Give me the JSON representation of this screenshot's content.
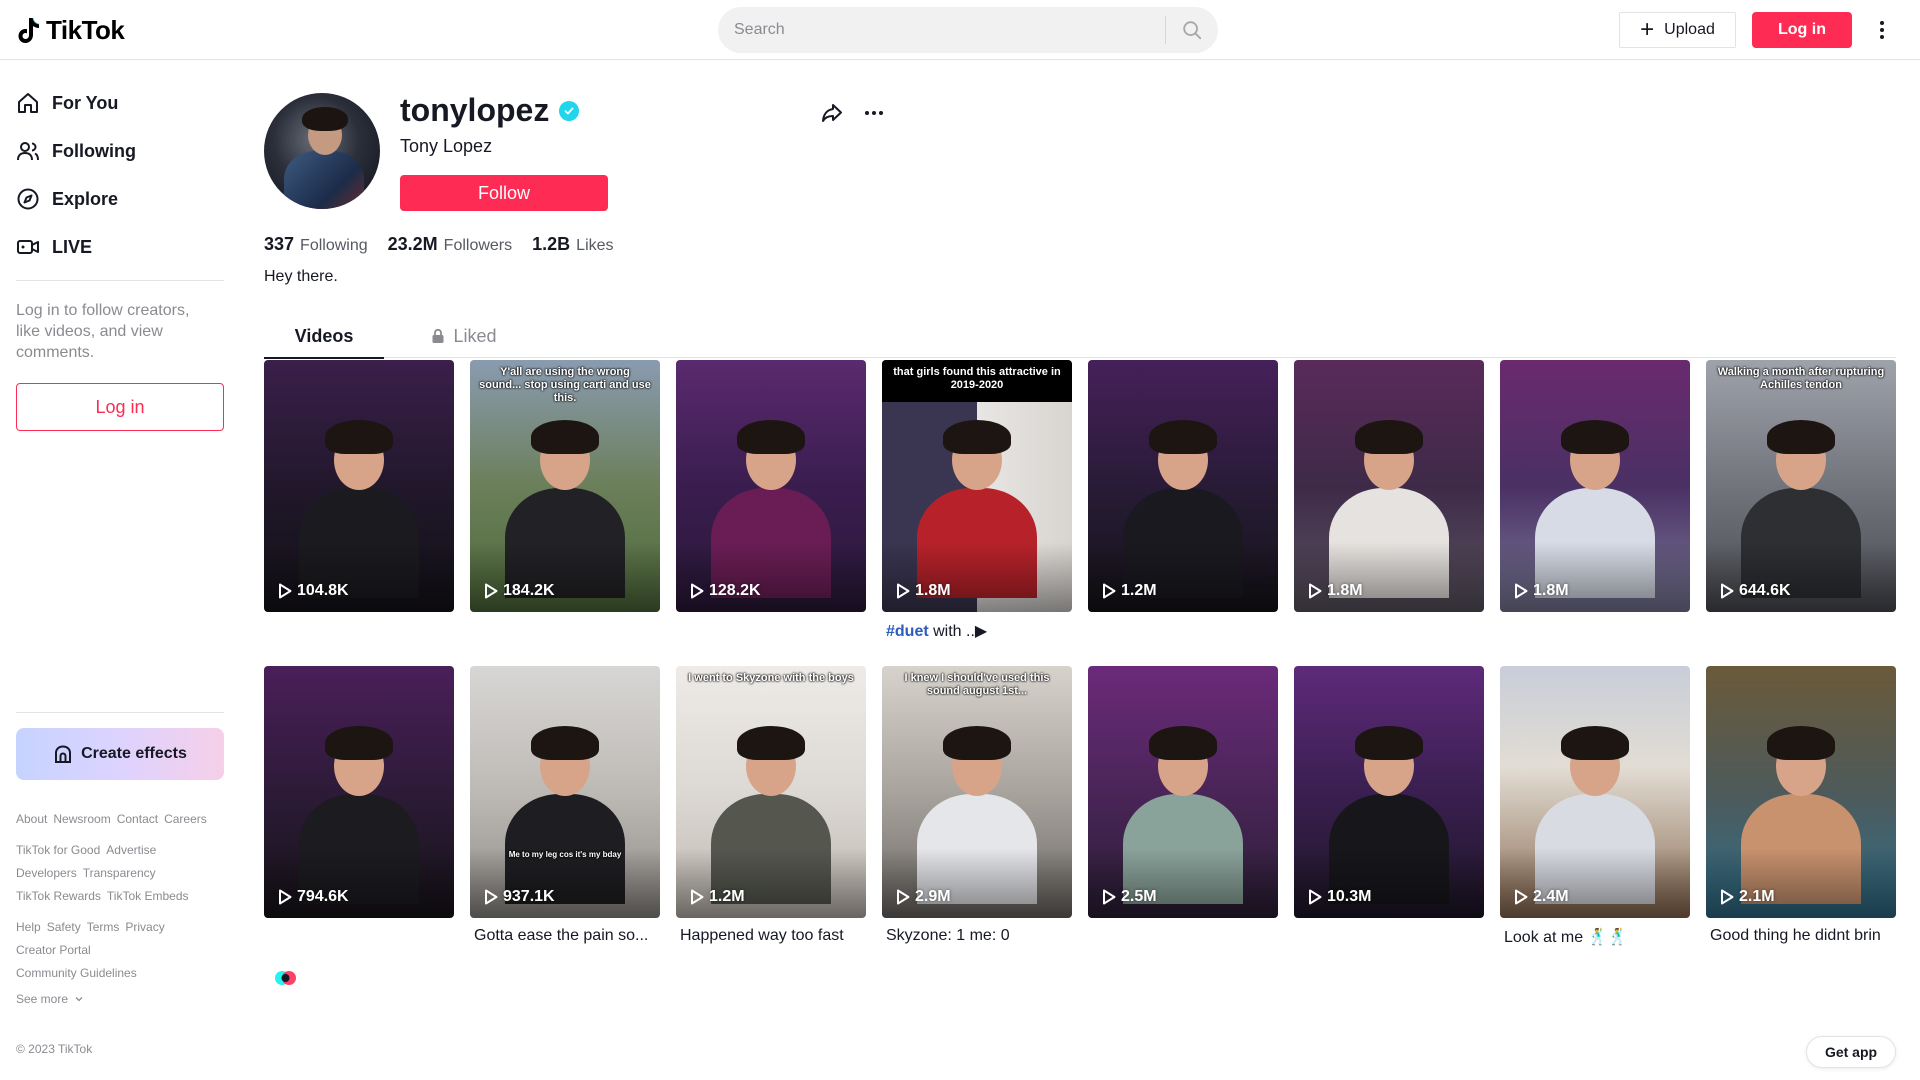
{
  "header": {
    "logo_text": "TikTok",
    "search_placeholder": "Search",
    "upload_label": "Upload",
    "login_label": "Log in"
  },
  "sidebar": {
    "nav": [
      {
        "label": "For You",
        "icon": "home-icon"
      },
      {
        "label": "Following",
        "icon": "people-icon"
      },
      {
        "label": "Explore",
        "icon": "compass-icon"
      },
      {
        "label": "LIVE",
        "icon": "live-camera-icon"
      }
    ],
    "login_hint": "Log in to follow creators, like videos, and view comments.",
    "login_button": "Log in",
    "create_effects": "Create effects",
    "footer_links": [
      [
        "About",
        "Newsroom",
        "Contact",
        "Careers"
      ],
      [
        "TikTok for Good",
        "Advertise"
      ],
      [
        "Developers",
        "Transparency"
      ],
      [
        "TikTok Rewards",
        "TikTok Embeds"
      ],
      [
        "Help",
        "Safety",
        "Terms",
        "Privacy"
      ],
      [
        "Creator Portal"
      ],
      [
        "Community Guidelines"
      ]
    ],
    "see_more": "See more",
    "copyright": "© 2023 TikTok"
  },
  "profile": {
    "username": "tonylopez",
    "nickname": "Tony Lopez",
    "follow_label": "Follow",
    "stats": {
      "following_count": "337",
      "following_label": "Following",
      "followers_count": "23.2M",
      "followers_label": "Followers",
      "likes_count": "1.2B",
      "likes_label": "Likes"
    },
    "bio": "Hey there."
  },
  "tabs": {
    "videos": "Videos",
    "liked": "Liked"
  },
  "videos": [
    {
      "views": "104.8K",
      "caption": "",
      "desc": "",
      "bg": "linear-gradient(180deg,#3a1f4a 0%,#1d1626 60%,#141218 100%)",
      "body": "#1b1a1f"
    },
    {
      "views": "184.2K",
      "caption": "Y'all are using the wrong sound... stop using carti and use this.",
      "desc": "",
      "bg": "linear-gradient(180deg,#8a9bb0 0%,#6b7f5a 50%,#4e6a3a 100%)",
      "body": "#222226"
    },
    {
      "views": "128.2K",
      "caption": "",
      "desc": "",
      "bg": "linear-gradient(180deg,#5a2a6e 0%,#3a1d4f 50%,#2a1838 100%)",
      "body": "#6a1d55"
    },
    {
      "views": "1.8M",
      "caption": "that girls found this attractive in 2019-2020",
      "desc_tag": "#duet",
      "desc": " with ..▶",
      "bg": "linear-gradient(90deg,#3a3550 0%,#3a3550 50%,#e8e6e4 50%,#d8d4d0 100%)",
      "body": "#b7222a",
      "top_black": true
    },
    {
      "views": "1.2M",
      "caption": "",
      "desc": "",
      "bg": "linear-gradient(180deg,#46205a 0%,#231a30 60%,#161218 100%)",
      "body": "#1a1920"
    },
    {
      "views": "1.8M",
      "caption": "",
      "desc": "",
      "bg": "linear-gradient(180deg,#5a2a5a 0%,#3e2a48 50%,#5b5560 100%)",
      "body": "#e6e2df"
    },
    {
      "views": "1.8M",
      "caption": "",
      "desc": "",
      "bg": "linear-gradient(180deg,#6a2a6e 0%,#4a3064 50%,#7c7d9a 100%)",
      "body": "#d7dbe6"
    },
    {
      "views": "644.6K",
      "caption": "Walking a month after rupturing Achilles tendon",
      "desc": "",
      "bg": "linear-gradient(180deg,#9ea2aa 0%,#6e7078 55%,#4a4c52 100%)",
      "body": "#2e2f33"
    },
    {
      "views": "794.6K",
      "caption": "",
      "desc": "",
      "bg": "linear-gradient(180deg,#4a1f5a 0%,#2a1a34 55%,#171318 100%)",
      "body": "#1c1b20"
    },
    {
      "views": "937.1K",
      "caption": "Me to my leg cos it's my bday",
      "caption_bottom": true,
      "desc": "Gotta ease the pain so...",
      "bg": "linear-gradient(180deg,#d8d6d4 0%,#bdbab6 50%,#8e8a86 100%)",
      "body": "#1e1d21"
    },
    {
      "views": "1.2M",
      "caption": "I went to Skyzone with the boys",
      "desc": "Happened way too fast",
      "bg": "linear-gradient(180deg,#eeebe8 0%,#dcd8d3 50%,#bfb8b0 100%)",
      "body": "#55574f"
    },
    {
      "views": "2.9M",
      "caption": "I knew I should've used this sound august 1st...",
      "desc": "Skyzone: 1 me: 0",
      "bg": "linear-gradient(180deg,#d7d2cc 0%,#a8a39d 50%,#6c6864 100%)",
      "body": "#e5e6ea"
    },
    {
      "views": "2.5M",
      "caption": "",
      "desc": "",
      "bg": "linear-gradient(180deg,#6b2a7a 0%,#4a2558 50%,#2a1e34 100%)",
      "body": "#8aa39a"
    },
    {
      "views": "10.3M",
      "caption": "",
      "desc": "",
      "bg": "linear-gradient(180deg,#5e2a7a 0%,#3a1f50 50%,#1d1626 100%)",
      "body": "#17161b"
    },
    {
      "views": "2.4M",
      "caption": "",
      "desc": "Look at me 🕺🕺",
      "bg": "linear-gradient(180deg,#c8cdd8 0%,#e2ddd4 40%,#8a6a50 100%)",
      "body": "#d8dbe2"
    },
    {
      "views": "2.1M",
      "caption": "",
      "desc": "Good thing he didnt brin",
      "bg": "linear-gradient(180deg,#6a5a3a 0%,#4e5a5a 50%,#2e6e8a 100%)",
      "body": "#c8926e"
    }
  ],
  "get_app": "Get app",
  "colors": {
    "accent": "#fe2c55",
    "verified": "#20d5ec",
    "hashtag": "#2b5db9"
  }
}
